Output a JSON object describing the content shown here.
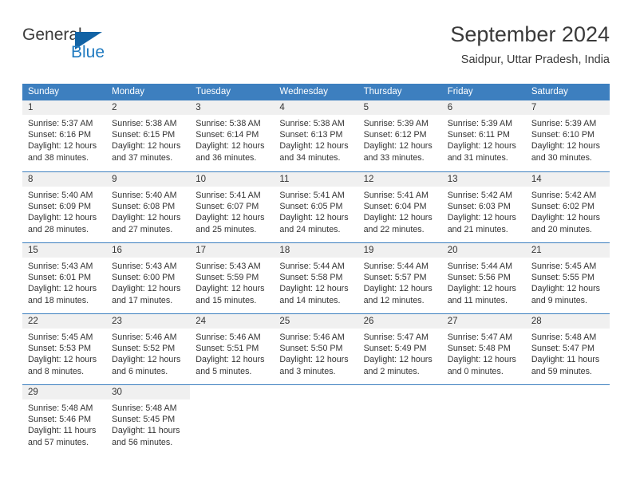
{
  "brand": {
    "name_part1": "General",
    "name_part2": "Blue",
    "logo_icon": "triangle-logo-icon"
  },
  "header": {
    "title": "September 2024",
    "location": "Saidpur, Uttar Pradesh, India"
  },
  "colors": {
    "header_blue": "#3d7fbf",
    "brand_blue": "#1f7ac0",
    "logo_blue": "#1263a5",
    "day_strip_gray": "#f0f0f0",
    "text": "#333333"
  },
  "weekdays": [
    "Sunday",
    "Monday",
    "Tuesday",
    "Wednesday",
    "Thursday",
    "Friday",
    "Saturday"
  ],
  "weeks": [
    [
      {
        "day": "1",
        "sunrise": "Sunrise: 5:37 AM",
        "sunset": "Sunset: 6:16 PM",
        "daylight_line1": "Daylight: 12 hours",
        "daylight_line2": "and 38 minutes."
      },
      {
        "day": "2",
        "sunrise": "Sunrise: 5:38 AM",
        "sunset": "Sunset: 6:15 PM",
        "daylight_line1": "Daylight: 12 hours",
        "daylight_line2": "and 37 minutes."
      },
      {
        "day": "3",
        "sunrise": "Sunrise: 5:38 AM",
        "sunset": "Sunset: 6:14 PM",
        "daylight_line1": "Daylight: 12 hours",
        "daylight_line2": "and 36 minutes."
      },
      {
        "day": "4",
        "sunrise": "Sunrise: 5:38 AM",
        "sunset": "Sunset: 6:13 PM",
        "daylight_line1": "Daylight: 12 hours",
        "daylight_line2": "and 34 minutes."
      },
      {
        "day": "5",
        "sunrise": "Sunrise: 5:39 AM",
        "sunset": "Sunset: 6:12 PM",
        "daylight_line1": "Daylight: 12 hours",
        "daylight_line2": "and 33 minutes."
      },
      {
        "day": "6",
        "sunrise": "Sunrise: 5:39 AM",
        "sunset": "Sunset: 6:11 PM",
        "daylight_line1": "Daylight: 12 hours",
        "daylight_line2": "and 31 minutes."
      },
      {
        "day": "7",
        "sunrise": "Sunrise: 5:39 AM",
        "sunset": "Sunset: 6:10 PM",
        "daylight_line1": "Daylight: 12 hours",
        "daylight_line2": "and 30 minutes."
      }
    ],
    [
      {
        "day": "8",
        "sunrise": "Sunrise: 5:40 AM",
        "sunset": "Sunset: 6:09 PM",
        "daylight_line1": "Daylight: 12 hours",
        "daylight_line2": "and 28 minutes."
      },
      {
        "day": "9",
        "sunrise": "Sunrise: 5:40 AM",
        "sunset": "Sunset: 6:08 PM",
        "daylight_line1": "Daylight: 12 hours",
        "daylight_line2": "and 27 minutes."
      },
      {
        "day": "10",
        "sunrise": "Sunrise: 5:41 AM",
        "sunset": "Sunset: 6:07 PM",
        "daylight_line1": "Daylight: 12 hours",
        "daylight_line2": "and 25 minutes."
      },
      {
        "day": "11",
        "sunrise": "Sunrise: 5:41 AM",
        "sunset": "Sunset: 6:05 PM",
        "daylight_line1": "Daylight: 12 hours",
        "daylight_line2": "and 24 minutes."
      },
      {
        "day": "12",
        "sunrise": "Sunrise: 5:41 AM",
        "sunset": "Sunset: 6:04 PM",
        "daylight_line1": "Daylight: 12 hours",
        "daylight_line2": "and 22 minutes."
      },
      {
        "day": "13",
        "sunrise": "Sunrise: 5:42 AM",
        "sunset": "Sunset: 6:03 PM",
        "daylight_line1": "Daylight: 12 hours",
        "daylight_line2": "and 21 minutes."
      },
      {
        "day": "14",
        "sunrise": "Sunrise: 5:42 AM",
        "sunset": "Sunset: 6:02 PM",
        "daylight_line1": "Daylight: 12 hours",
        "daylight_line2": "and 20 minutes."
      }
    ],
    [
      {
        "day": "15",
        "sunrise": "Sunrise: 5:43 AM",
        "sunset": "Sunset: 6:01 PM",
        "daylight_line1": "Daylight: 12 hours",
        "daylight_line2": "and 18 minutes."
      },
      {
        "day": "16",
        "sunrise": "Sunrise: 5:43 AM",
        "sunset": "Sunset: 6:00 PM",
        "daylight_line1": "Daylight: 12 hours",
        "daylight_line2": "and 17 minutes."
      },
      {
        "day": "17",
        "sunrise": "Sunrise: 5:43 AM",
        "sunset": "Sunset: 5:59 PM",
        "daylight_line1": "Daylight: 12 hours",
        "daylight_line2": "and 15 minutes."
      },
      {
        "day": "18",
        "sunrise": "Sunrise: 5:44 AM",
        "sunset": "Sunset: 5:58 PM",
        "daylight_line1": "Daylight: 12 hours",
        "daylight_line2": "and 14 minutes."
      },
      {
        "day": "19",
        "sunrise": "Sunrise: 5:44 AM",
        "sunset": "Sunset: 5:57 PM",
        "daylight_line1": "Daylight: 12 hours",
        "daylight_line2": "and 12 minutes."
      },
      {
        "day": "20",
        "sunrise": "Sunrise: 5:44 AM",
        "sunset": "Sunset: 5:56 PM",
        "daylight_line1": "Daylight: 12 hours",
        "daylight_line2": "and 11 minutes."
      },
      {
        "day": "21",
        "sunrise": "Sunrise: 5:45 AM",
        "sunset": "Sunset: 5:55 PM",
        "daylight_line1": "Daylight: 12 hours",
        "daylight_line2": "and 9 minutes."
      }
    ],
    [
      {
        "day": "22",
        "sunrise": "Sunrise: 5:45 AM",
        "sunset": "Sunset: 5:53 PM",
        "daylight_line1": "Daylight: 12 hours",
        "daylight_line2": "and 8 minutes."
      },
      {
        "day": "23",
        "sunrise": "Sunrise: 5:46 AM",
        "sunset": "Sunset: 5:52 PM",
        "daylight_line1": "Daylight: 12 hours",
        "daylight_line2": "and 6 minutes."
      },
      {
        "day": "24",
        "sunrise": "Sunrise: 5:46 AM",
        "sunset": "Sunset: 5:51 PM",
        "daylight_line1": "Daylight: 12 hours",
        "daylight_line2": "and 5 minutes."
      },
      {
        "day": "25",
        "sunrise": "Sunrise: 5:46 AM",
        "sunset": "Sunset: 5:50 PM",
        "daylight_line1": "Daylight: 12 hours",
        "daylight_line2": "and 3 minutes."
      },
      {
        "day": "26",
        "sunrise": "Sunrise: 5:47 AM",
        "sunset": "Sunset: 5:49 PM",
        "daylight_line1": "Daylight: 12 hours",
        "daylight_line2": "and 2 minutes."
      },
      {
        "day": "27",
        "sunrise": "Sunrise: 5:47 AM",
        "sunset": "Sunset: 5:48 PM",
        "daylight_line1": "Daylight: 12 hours",
        "daylight_line2": "and 0 minutes."
      },
      {
        "day": "28",
        "sunrise": "Sunrise: 5:48 AM",
        "sunset": "Sunset: 5:47 PM",
        "daylight_line1": "Daylight: 11 hours",
        "daylight_line2": "and 59 minutes."
      }
    ],
    [
      {
        "day": "29",
        "sunrise": "Sunrise: 5:48 AM",
        "sunset": "Sunset: 5:46 PM",
        "daylight_line1": "Daylight: 11 hours",
        "daylight_line2": "and 57 minutes."
      },
      {
        "day": "30",
        "sunrise": "Sunrise: 5:48 AM",
        "sunset": "Sunset: 5:45 PM",
        "daylight_line1": "Daylight: 11 hours",
        "daylight_line2": "and 56 minutes."
      },
      {
        "day": "",
        "sunrise": "",
        "sunset": "",
        "daylight_line1": "",
        "daylight_line2": ""
      },
      {
        "day": "",
        "sunrise": "",
        "sunset": "",
        "daylight_line1": "",
        "daylight_line2": ""
      },
      {
        "day": "",
        "sunrise": "",
        "sunset": "",
        "daylight_line1": "",
        "daylight_line2": ""
      },
      {
        "day": "",
        "sunrise": "",
        "sunset": "",
        "daylight_line1": "",
        "daylight_line2": ""
      },
      {
        "day": "",
        "sunrise": "",
        "sunset": "",
        "daylight_line1": "",
        "daylight_line2": ""
      }
    ]
  ]
}
